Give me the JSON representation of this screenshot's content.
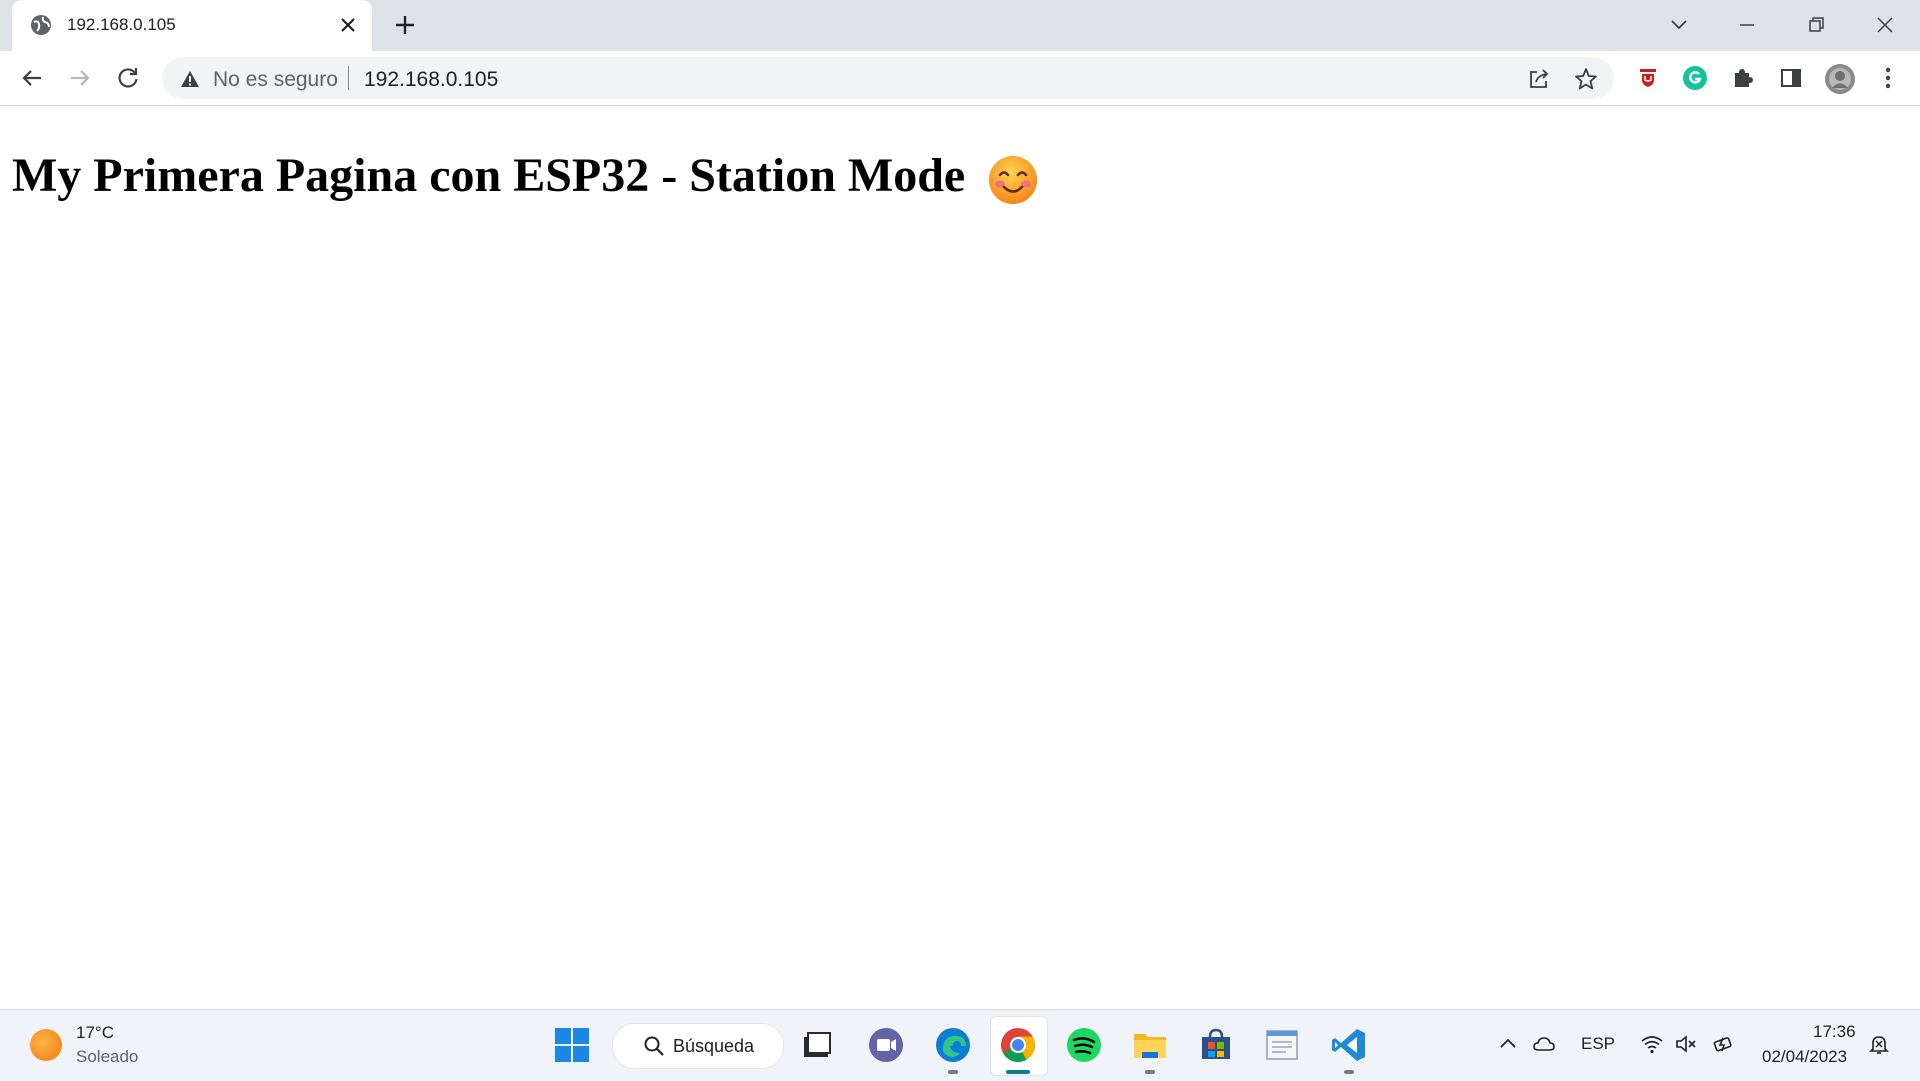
{
  "browser": {
    "tab": {
      "title": "192.168.0.105"
    },
    "address_bar": {
      "security_label": "No es seguro",
      "url": "192.168.0.105"
    },
    "icons": {
      "tab_favicon": "globe-icon",
      "tab_close": "close-icon",
      "new_tab": "plus-icon",
      "tab_search": "chevron-down-icon",
      "minimize": "minimize-icon",
      "restore": "restore-icon",
      "close_window": "close-icon",
      "back": "back-arrow-icon",
      "forward": "forward-arrow-icon",
      "reload": "reload-icon",
      "security_warning": "warning-triangle-icon",
      "share": "share-icon",
      "bookmark": "star-icon",
      "extension_shield": "shield-extension-icon",
      "extension_grammarly": "grammarly-icon",
      "extensions": "puzzle-icon",
      "side_panel": "side-panel-icon",
      "profile": "avatar-icon",
      "menu": "kebab-menu-icon"
    }
  },
  "page": {
    "heading": "My Primera Pagina con ESP32 - Station Mode",
    "heading_emoji": "smiling-face-icon"
  },
  "taskbar": {
    "weather": {
      "temperature": "17°C",
      "condition": "Soleado"
    },
    "search": {
      "label": "Búsqueda"
    },
    "apps": [
      "windows-start-icon",
      "file-manager-icon",
      "teams-icon",
      "edge-icon",
      "chrome-icon",
      "spotify-icon",
      "file-explorer-icon",
      "store-icon",
      "notepad-icon",
      "vscode-icon"
    ],
    "tray": {
      "language": "ESP",
      "time": "17:36",
      "date": "02/04/2023"
    }
  },
  "colors": {
    "tabstrip_bg": "#dee1e6",
    "omnibox_bg": "#f1f3f4",
    "taskbar_bg": "#f0f3f9",
    "chrome_active_indicator": "#0a7d8c"
  }
}
